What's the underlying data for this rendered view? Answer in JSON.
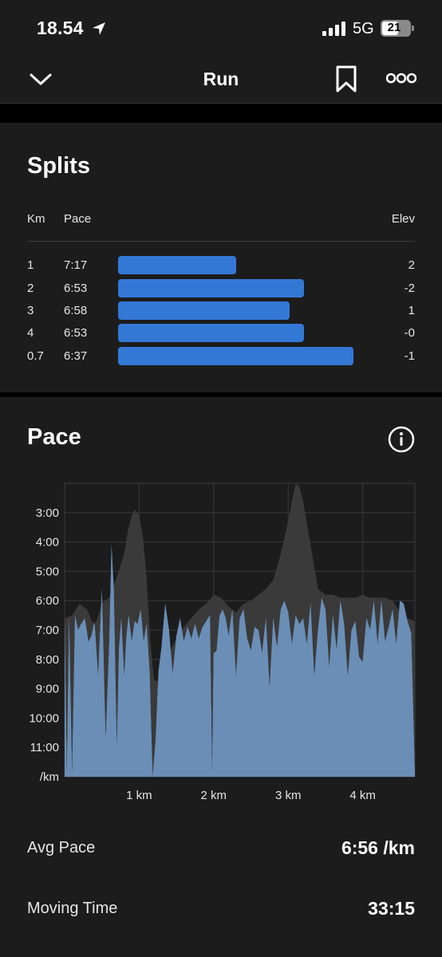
{
  "status_bar": {
    "time": "18.54",
    "network": "5G",
    "battery": "21"
  },
  "nav": {
    "title": "Run"
  },
  "splits": {
    "title": "Splits",
    "headers": {
      "km": "Km",
      "pace": "Pace",
      "elev": "Elev"
    },
    "rows": [
      {
        "km": "1",
        "pace": "7:17",
        "bar_fraction": 0.5,
        "elev": "2"
      },
      {
        "km": "2",
        "pace": "6:53",
        "bar_fraction": 0.79,
        "elev": "-2"
      },
      {
        "km": "3",
        "pace": "6:58",
        "bar_fraction": 0.73,
        "elev": "1"
      },
      {
        "km": "4",
        "pace": "6:53",
        "bar_fraction": 0.79,
        "elev": "-0"
      },
      {
        "km": "0.7",
        "pace": "6:37",
        "bar_fraction": 1.0,
        "elev": "-1"
      }
    ]
  },
  "pace": {
    "title": "Pace",
    "avg_pace_label": "Avg Pace",
    "avg_pace_value": "6:56 /km",
    "moving_time_label": "Moving Time",
    "moving_time_value": "33:15"
  },
  "chart_data": {
    "type": "area",
    "y_tick_labels": [
      "3:00",
      "4:00",
      "5:00",
      "6:00",
      "7:00",
      "8:00",
      "9:00",
      "10:00",
      "11:00",
      "/km"
    ],
    "x_tick_labels": [
      "1 km",
      "2 km",
      "3 km",
      "4 km"
    ],
    "x_ticks_km": [
      1,
      2,
      3,
      4
    ],
    "x_range_km": [
      0,
      4.7
    ],
    "y_range_min_per_km": [
      2,
      12
    ],
    "grid": true,
    "colors": {
      "pace_fill": "#6a89ad",
      "pace_highlight": "#6fa7e8",
      "elevation_fill": "#3a3a3a"
    },
    "series": [
      {
        "role": "pace",
        "x": [
          0,
          0.03,
          0.06,
          0.1,
          0.14,
          0.18,
          0.22,
          0.27,
          0.32,
          0.36,
          0.4,
          0.45,
          0.5,
          0.55,
          0.6,
          0.63,
          0.66,
          0.7,
          0.73,
          0.76,
          0.8,
          0.83,
          0.86,
          0.9,
          0.94,
          0.98,
          1.02,
          1.06,
          1.1,
          1.14,
          1.18,
          1.22,
          1.26,
          1.3,
          1.35,
          1.4,
          1.45,
          1.5,
          1.55,
          1.6,
          1.65,
          1.7,
          1.75,
          1.8,
          1.85,
          1.9,
          1.95,
          1.98,
          2.0,
          2.04,
          2.08,
          2.12,
          2.16,
          2.2,
          2.25,
          2.3,
          2.35,
          2.4,
          2.45,
          2.5,
          2.55,
          2.6,
          2.65,
          2.7,
          2.75,
          2.8,
          2.85,
          2.9,
          2.95,
          3.0,
          3.05,
          3.1,
          3.15,
          3.2,
          3.25,
          3.3,
          3.35,
          3.4,
          3.45,
          3.5,
          3.55,
          3.6,
          3.65,
          3.7,
          3.75,
          3.8,
          3.85,
          3.9,
          3.95,
          4.0,
          4.05,
          4.1,
          4.15,
          4.2,
          4.25,
          4.3,
          4.35,
          4.4,
          4.45,
          4.5,
          4.55,
          4.6,
          4.65,
          4.7
        ],
        "y": [
          6.7,
          12.0,
          6.6,
          12.0,
          6.5,
          7.0,
          6.8,
          6.6,
          7.4,
          7.2,
          6.7,
          8.6,
          5.6,
          10.8,
          7.4,
          4.1,
          5.6,
          11.1,
          7.6,
          6.6,
          8.6,
          7.2,
          6.5,
          7.4,
          6.7,
          6.8,
          6.3,
          7.4,
          6.8,
          8.4,
          12.0,
          10.8,
          8.4,
          7.6,
          6.1,
          7.0,
          8.5,
          7.2,
          6.6,
          7.4,
          6.9,
          7.3,
          6.8,
          7.3,
          6.9,
          6.7,
          6.5,
          12.0,
          7.8,
          7.7,
          6.5,
          6.3,
          6.6,
          7.2,
          6.3,
          8.6,
          6.6,
          6.3,
          7.3,
          7.7,
          6.9,
          7.0,
          7.8,
          6.6,
          9.0,
          6.6,
          7.6,
          6.3,
          6.0,
          6.4,
          7.5,
          6.5,
          6.8,
          6.6,
          7.5,
          6.1,
          8.6,
          7.0,
          5.9,
          6.3,
          8.3,
          6.5,
          7.7,
          6.0,
          6.8,
          8.6,
          7.0,
          6.7,
          7.9,
          8.1,
          6.6,
          7.0,
          6.0,
          7.5,
          6.0,
          7.4,
          6.9,
          6.3,
          7.5,
          6.0,
          6.1,
          6.7,
          7.1,
          12.0
        ]
      },
      {
        "role": "elevation",
        "x": [
          0,
          0.1,
          0.2,
          0.3,
          0.4,
          0.5,
          0.6,
          0.7,
          0.8,
          0.85,
          0.9,
          0.95,
          1.0,
          1.05,
          1.1,
          1.15,
          1.2,
          1.3,
          1.4,
          1.5,
          1.6,
          1.7,
          1.8,
          1.9,
          2.0,
          2.1,
          2.2,
          2.3,
          2.4,
          2.5,
          2.6,
          2.7,
          2.8,
          2.9,
          3.0,
          3.05,
          3.1,
          3.15,
          3.2,
          3.3,
          3.4,
          3.5,
          3.6,
          3.7,
          3.8,
          3.9,
          4.0,
          4.1,
          4.2,
          4.3,
          4.4,
          4.5,
          4.6,
          4.7
        ],
        "y": [
          6.6,
          6.5,
          6.1,
          6.3,
          6.9,
          6.1,
          5.9,
          5.2,
          4.4,
          3.6,
          3.1,
          2.9,
          3.1,
          3.8,
          5.2,
          7.4,
          8.7,
          8.8,
          7.8,
          7.3,
          6.9,
          6.6,
          6.3,
          6.1,
          5.8,
          5.9,
          6.2,
          6.4,
          6.1,
          6.0,
          5.8,
          5.6,
          5.3,
          4.4,
          3.3,
          2.6,
          2.0,
          2.1,
          2.6,
          4.1,
          5.6,
          5.8,
          5.8,
          5.9,
          5.9,
          5.9,
          5.8,
          5.9,
          5.9,
          5.9,
          6.0,
          6.4,
          6.6,
          6.7
        ]
      }
    ]
  }
}
